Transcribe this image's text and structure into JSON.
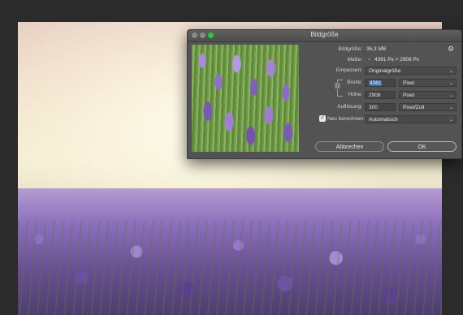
{
  "dialog": {
    "title": "Bildgröße",
    "image_size_label": "Bildgröße:",
    "image_size_value": "36,3 MB",
    "dimensions_label": "Maße:",
    "dimensions_value": "4361 Px  ×  2908 Px",
    "fit_label": "Einpassen:",
    "fit_value": "Originalgröße",
    "width_label": "Breite:",
    "width_value": "4361",
    "width_unit": "Pixel",
    "height_label": "Höhe:",
    "height_value": "2908",
    "height_unit": "Pixel",
    "resolution_label": "Auflösung:",
    "resolution_value": "300",
    "resolution_unit": "Pixel/Zoll",
    "resample_label": "Neu berechnen:",
    "resample_value": "Automatisch",
    "resample_checked": true,
    "cancel_label": "Abbrechen",
    "ok_label": "OK",
    "dimensions_icon": "chevron-down-icon",
    "settings_icon": "gear-icon",
    "link_icon": "chain-link-icon"
  },
  "colors": {
    "dialog_bg": "#535353",
    "selection": "#3b6ea5",
    "zoom_button": "#27c93f"
  }
}
